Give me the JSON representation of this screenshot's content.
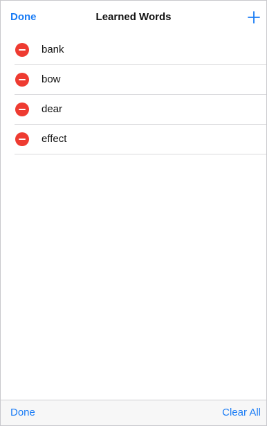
{
  "nav": {
    "done_label": "Done",
    "title": "Learned Words",
    "add_icon": "plus-icon"
  },
  "colors": {
    "accent": "#1a7cf5",
    "delete": "#ee3b31"
  },
  "words": [
    "bank",
    "bow",
    "dear",
    "effect"
  ],
  "toolbar": {
    "done_label": "Done",
    "clear_label": "Clear All"
  }
}
